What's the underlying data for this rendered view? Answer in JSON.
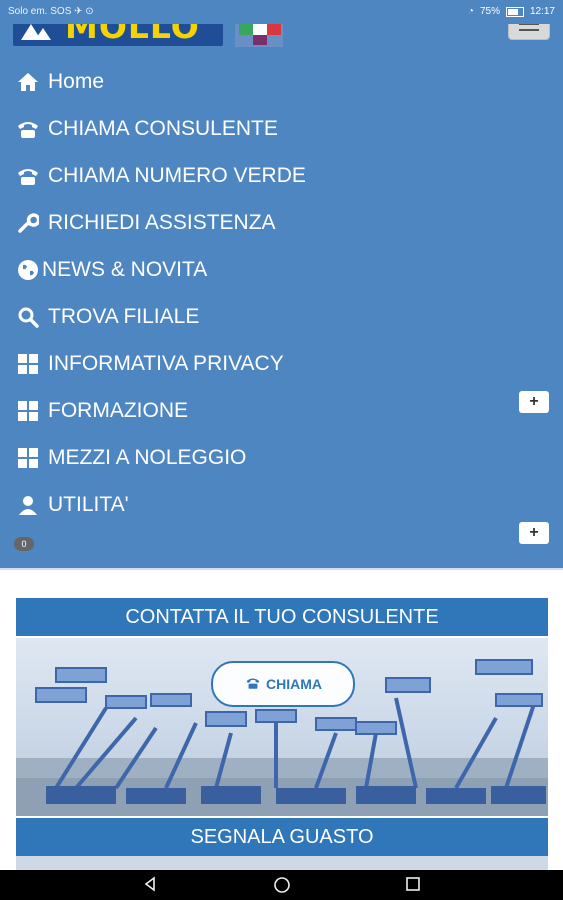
{
  "status_bar": {
    "left": "Solo em. SOS ✈ ⊙",
    "battery": "75%",
    "time": "12:17"
  },
  "header": {
    "logo_text": "MOLLO"
  },
  "menu": {
    "items": [
      {
        "label": "Home",
        "icon": "home-icon"
      },
      {
        "label": "CHIAMA CONSULENTE",
        "icon": "phone-icon"
      },
      {
        "label": "CHIAMA NUMERO VERDE",
        "icon": "phone-icon"
      },
      {
        "label": "RICHIEDI ASSISTENZA",
        "icon": "wrench-icon"
      },
      {
        "label": "NEWS & NOVITA",
        "icon": "globe-icon"
      },
      {
        "label": "TROVA FILIALE",
        "icon": "search-icon"
      },
      {
        "label": "INFORMATIVA PRIVACY",
        "icon": "grid-icon"
      },
      {
        "label": "FORMAZIONE",
        "icon": "grid-icon"
      },
      {
        "label": "MEZZI A NOLEGGIO",
        "icon": "grid-icon"
      },
      {
        "label": "UTILITA'",
        "icon": "user-icon"
      }
    ],
    "expand_label": "+",
    "counter": "0"
  },
  "contact_panel": {
    "title": "CONTATTA IL TUO CONSULENTE",
    "button_label": "CHIAMA"
  },
  "fault_panel": {
    "title": "SEGNALA GUASTO"
  },
  "colors": {
    "primary": "#4e86c2",
    "panel": "#2f77b9",
    "logo_bg": "#1f4e97",
    "logo_text": "#f5d300"
  }
}
